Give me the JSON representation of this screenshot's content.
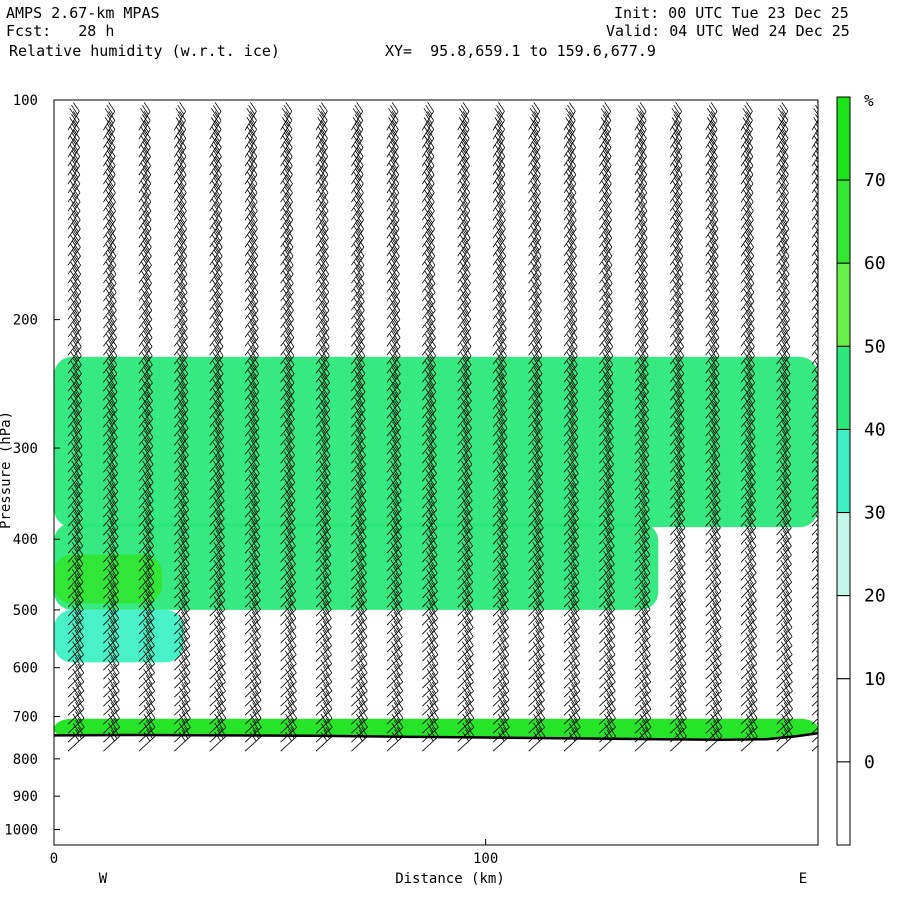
{
  "header": {
    "model": "AMPS 2.67-km MPAS",
    "fcst": "Fcst:   28 h",
    "field": "Relative humidity (w.r.t. ice)",
    "xy": "XY=  95.8,659.1 to 159.6,677.9",
    "init": "Init: 00 UTC Tue 23 Dec 25",
    "valid": "Valid: 04 UTC Wed 24 Dec 25"
  },
  "chart_data": {
    "type": "heatmap",
    "title": "Relative humidity (w.r.t. ice)",
    "xlabel": "Distance (km)",
    "ylabel": "Pressure (hPa)",
    "x_ticks": [
      0,
      100
    ],
    "x_tick_labels": [
      "0",
      "100"
    ],
    "xlim": [
      0,
      177
    ],
    "y_ticks": [
      100,
      200,
      300,
      400,
      500,
      600,
      700,
      800,
      900,
      1000
    ],
    "ylim": [
      1050,
      100
    ],
    "y_scale": "log",
    "left_label": "W",
    "right_label": "E",
    "colorbar": {
      "unit": "%",
      "levels": [
        0,
        10,
        20,
        30,
        40,
        50,
        60,
        70
      ],
      "colors": [
        "#ffffff",
        "#ffffff",
        "#ffffff",
        "#c2f7e9",
        "#3ef0c4",
        "#2be87a",
        "#6bf04a",
        "#32e632",
        "#1ce31c"
      ]
    },
    "terrain_surface_hPa": [
      {
        "x": 0,
        "p": 743
      },
      {
        "x": 20,
        "p": 742
      },
      {
        "x": 40,
        "p": 743
      },
      {
        "x": 60,
        "p": 744
      },
      {
        "x": 80,
        "p": 746
      },
      {
        "x": 100,
        "p": 748
      },
      {
        "x": 120,
        "p": 750
      },
      {
        "x": 140,
        "p": 752
      },
      {
        "x": 155,
        "p": 753
      },
      {
        "x": 165,
        "p": 752
      },
      {
        "x": 172,
        "p": 745
      },
      {
        "x": 177,
        "p": 738
      }
    ],
    "rh_regions": [
      {
        "level": 40,
        "desc": "upper moist layer",
        "x": [
          0,
          177
        ],
        "p": [
          225,
          385
        ]
      },
      {
        "level": 40,
        "desc": "mid moist layer",
        "x": [
          0,
          140
        ],
        "p": [
          380,
          500
        ]
      },
      {
        "level": 30,
        "desc": "lower moist tail",
        "x": [
          0,
          30
        ],
        "p": [
          500,
          590
        ]
      },
      {
        "level": 60,
        "desc": "moist core",
        "x": [
          0,
          25
        ],
        "p": [
          420,
          490
        ]
      },
      {
        "level": 70,
        "desc": "near-surface saturated layer",
        "x": [
          0,
          177
        ],
        "p": [
          705,
          750
        ]
      }
    ],
    "wind_barb_columns_count": 22
  }
}
